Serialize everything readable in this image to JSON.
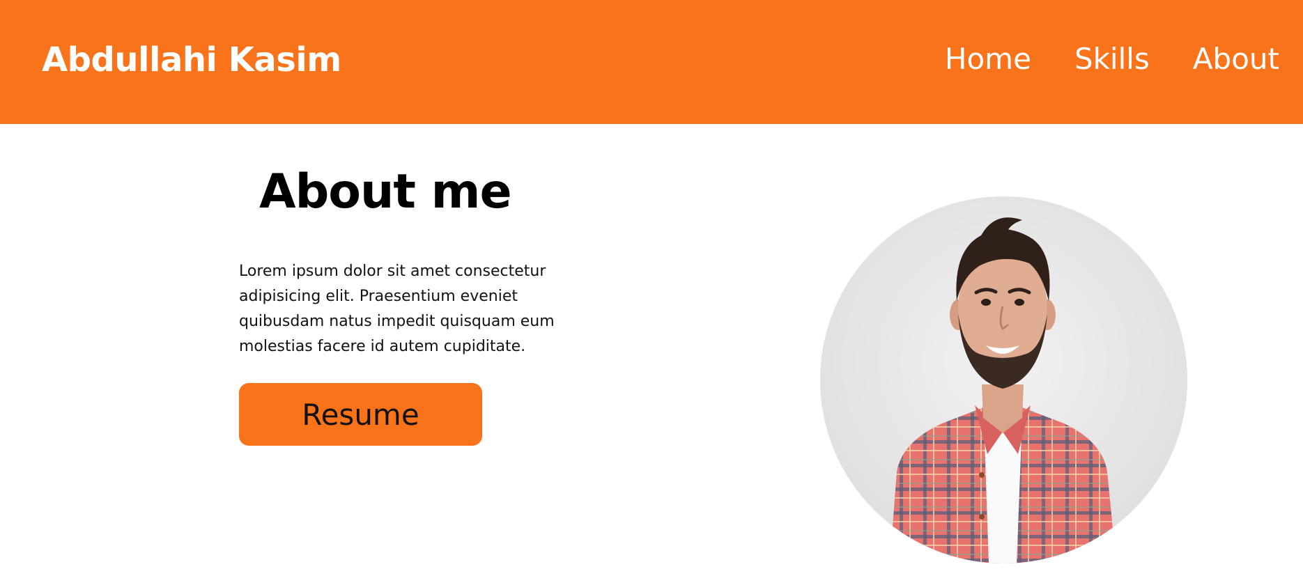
{
  "header": {
    "brand": "Abdullahi Kasim",
    "nav": [
      {
        "label": "Home"
      },
      {
        "label": "Skills"
      },
      {
        "label": "About"
      }
    ]
  },
  "about": {
    "title": "About me",
    "text": "Lorem ipsum dolor sit amet consectetur adipisicing elit. Praesentium eveniet quibusdam natus impedit quisquam eum molestias facere id autem cupiditate.",
    "button_label": "Resume"
  },
  "colors": {
    "accent": "#f8731a",
    "header_text": "#ffffff",
    "body_text": "#000000"
  },
  "icons": {
    "avatar": "profile-photo"
  }
}
